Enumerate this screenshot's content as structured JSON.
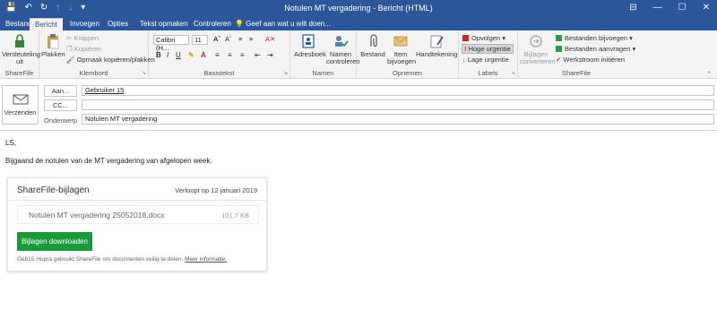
{
  "window": {
    "title": "Notulen MT vergadering  -  Bericht (HTML)",
    "controls": [
      "⊟",
      "—",
      "☐",
      "✕"
    ]
  },
  "tabs": [
    {
      "label": "Bestand",
      "active": false
    },
    {
      "label": "Bericht",
      "active": true
    },
    {
      "label": "Invoegen",
      "active": false
    },
    {
      "label": "Opties",
      "active": false
    },
    {
      "label": "Tekst opmaken",
      "active": false
    },
    {
      "label": "Controleren",
      "active": false
    }
  ],
  "tellme": "Geef aan wat u wilt doen...",
  "ribbon": {
    "sharefile1": {
      "label": "ShareFile",
      "versleuteling": "Versleuteling\nuit"
    },
    "klembord": {
      "label": "Klembord",
      "plakken": "Plakken",
      "knippen": "Knippen",
      "kopieren": "Kopiëren",
      "opmaak": "Opmaak kopiëren/plakken"
    },
    "basistekst": {
      "label": "Basistekst",
      "font": "Calibri (H…",
      "size": "11"
    },
    "namen": {
      "label": "Namen",
      "adresboek": "Adresboek",
      "controleren": "Namen\ncontroleren"
    },
    "opnemen": {
      "label": "Opnemen",
      "bestand": "Bestand",
      "item": "Item\nbijvoegen",
      "handtekening": "Handtekening"
    },
    "labels": {
      "label": "Labels",
      "opvolgen": "Opvolgen",
      "hoge": "Hoge urgentie",
      "lage": "Lage urgentie"
    },
    "sharefile2": {
      "label": "ShareFile",
      "bijlagen": "Bijlagen\nconverteren",
      "bijvoegen": "Bestanden bijvoegen",
      "aanvragen": "Bestanden aanvragen",
      "werkstroom": "Werkstroom initiëren"
    }
  },
  "compose": {
    "send": "Verzenden",
    "to_button": "Aan...",
    "to_value": "Gebruiker 15",
    "cc_button": "CC...",
    "cc_value": "",
    "subject_label": "Onderwerp",
    "subject_value": "Notulen MT vergadering"
  },
  "body": {
    "greeting": "LS,",
    "line": "Bijgaand de notulen van de MT vergadering van afgelopen week."
  },
  "sharefile_card": {
    "title": "ShareFile-bijlagen",
    "expires": "Verloopt op 12 januari 2019",
    "file_name": "Notulen MT vergadering 25052018.docx",
    "file_size": "101,7 KB",
    "download": "Bijlagen downloaden",
    "footer": "Geb15 Hupra gebruikt ShareFile om documenten veilig te delen.",
    "footer_link": "Meer informatie."
  },
  "colors": {
    "titlebar": "#2b579a",
    "ribbon": "#f3f3f3",
    "download": "#1c9a3b"
  }
}
